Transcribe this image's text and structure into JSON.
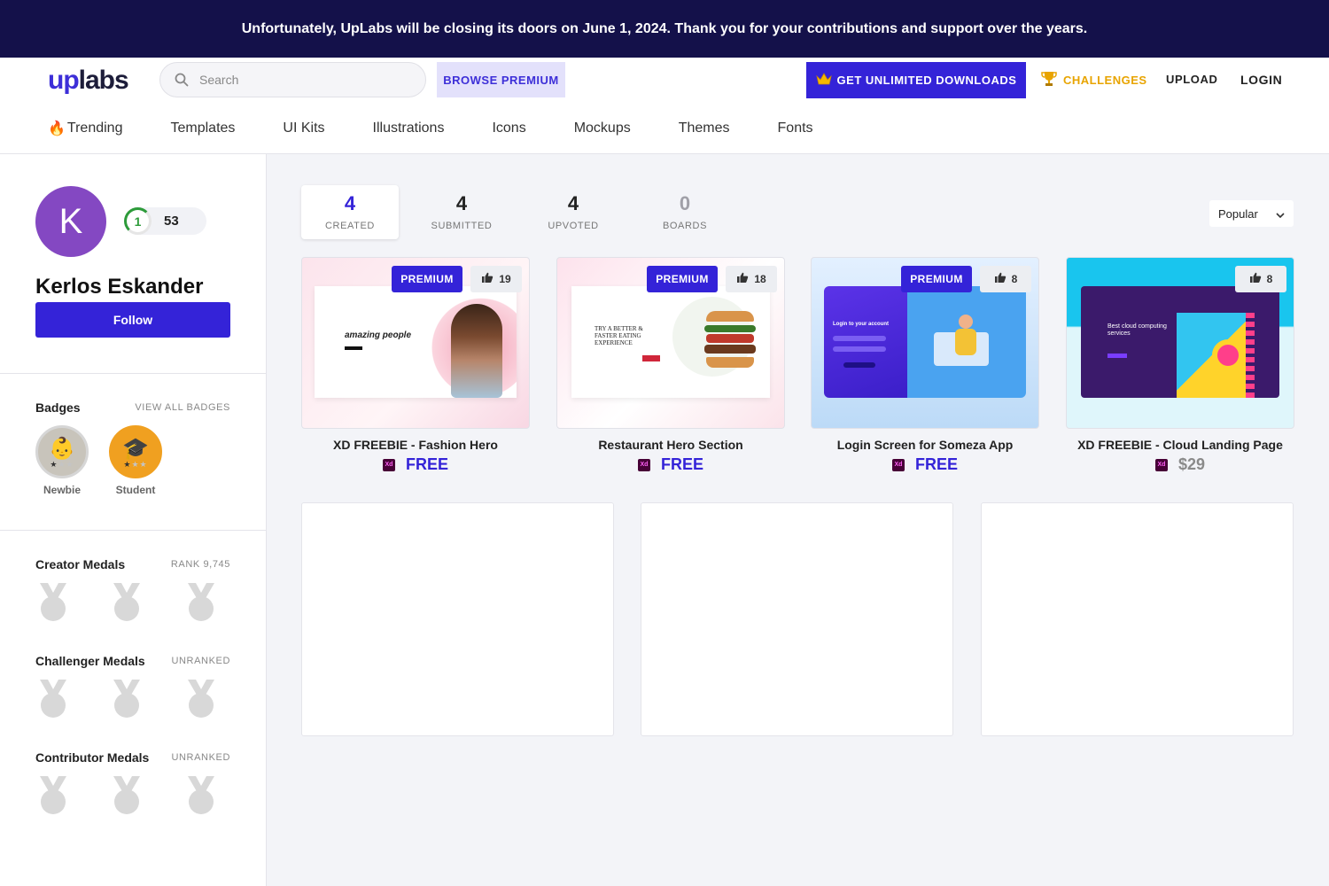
{
  "banner": {
    "text": "Unfortunately, UpLabs will be closing its doors on June 1, 2024. Thank you for your contributions and support over the years."
  },
  "header": {
    "logo_up": "up",
    "logo_labs": "labs",
    "search_placeholder": "Search",
    "browse_premium": "BROWSE PREMIUM",
    "get_unlimited": "GET UNLIMITED DOWNLOADS",
    "challenges": "CHALLENGES",
    "upload": "UPLOAD",
    "login": "LOGIN"
  },
  "nav": [
    "Trending",
    "Templates",
    "UI Kits",
    "Illustrations",
    "Icons",
    "Mockups",
    "Themes",
    "Fonts"
  ],
  "profile": {
    "initial": "K",
    "level": "1",
    "points": "53",
    "name": "Kerlos Eskander",
    "follow": "Follow"
  },
  "badges": {
    "title": "Badges",
    "view_all": "VIEW ALL BADGES",
    "items": [
      {
        "label": "Newbie",
        "icon": "baby-icon",
        "color": "#c8c4bb",
        "stars_on": 1
      },
      {
        "label": "Student",
        "icon": "graduation-cap-icon",
        "color": "#f0a020",
        "stars_on": 1
      }
    ]
  },
  "medals": [
    {
      "title": "Creator Medals",
      "rank": "RANK 9,745"
    },
    {
      "title": "Challenger Medals",
      "rank": "UNRANKED"
    },
    {
      "title": "Contributor Medals",
      "rank": "UNRANKED"
    }
  ],
  "tabs": [
    {
      "count": "4",
      "label": "CREATED",
      "active": true
    },
    {
      "count": "4",
      "label": "SUBMITTED",
      "active": false
    },
    {
      "count": "4",
      "label": "UPVOTED",
      "active": false
    },
    {
      "count": "0",
      "label": "BOARDS",
      "active": false
    }
  ],
  "sort": {
    "value": "Popular"
  },
  "cards": [
    {
      "title": "XD FREEBIE - Fashion Hero",
      "price": "FREE",
      "likes": "19",
      "premium": "PREMIUM",
      "tool": "Xd",
      "thumb_text": "amazing people"
    },
    {
      "title": "Restaurant Hero Section",
      "price": "FREE",
      "likes": "18",
      "premium": "PREMIUM",
      "tool": "Xd",
      "thumb_text": "TRY A BETTER & FASTER EATING EXPERIENCE"
    },
    {
      "title": "Login Screen for Someza App",
      "price": "FREE",
      "likes": "8",
      "premium": "PREMIUM",
      "tool": "Xd",
      "thumb_text": "Login to your account"
    },
    {
      "title": "XD FREEBIE - Cloud Landing Page",
      "price": "$29",
      "likes": "8",
      "premium": "",
      "tool": "Xd",
      "thumb_text": "Best cloud computing services"
    }
  ],
  "colors": {
    "brand": "#3423d8",
    "banner": "#14114a",
    "avatar": "#8448c2",
    "challenges": "#e8a400"
  }
}
